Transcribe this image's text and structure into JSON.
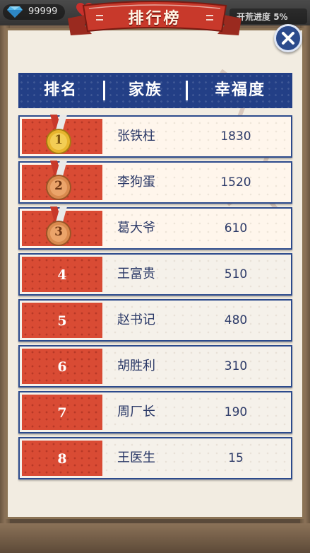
{
  "hud": {
    "gems": "99999",
    "progress_label": "开荒进度",
    "progress_value": "5%"
  },
  "title": "排行榜",
  "table": {
    "columns": [
      "排名",
      "家族",
      "幸福度"
    ],
    "rows": [
      {
        "rank": "1",
        "name": "张铁柱",
        "score": "1830",
        "medal": "gold"
      },
      {
        "rank": "2",
        "name": "李狗蛋",
        "score": "1520",
        "medal": "bronze"
      },
      {
        "rank": "3",
        "name": "葛大爷",
        "score": "610",
        "medal": "bronze"
      },
      {
        "rank": "4",
        "name": "王富贵",
        "score": "510"
      },
      {
        "rank": "5",
        "name": "赵书记",
        "score": "480"
      },
      {
        "rank": "6",
        "name": "胡胜利",
        "score": "310"
      },
      {
        "rank": "7",
        "name": "周厂长",
        "score": "190"
      },
      {
        "rank": "8",
        "name": "王医生",
        "score": "15"
      }
    ]
  },
  "colors": {
    "header_blue": "#233f86",
    "rank_red": "#d94b34",
    "banner_red": "#c8392b",
    "medal_gold": "#e7b52e",
    "medal_bronze": "#d98a4e"
  },
  "icons": {
    "close": "close-icon",
    "gem": "diamond-icon",
    "heart": "heart-icon",
    "medal": "medal-icon"
  }
}
